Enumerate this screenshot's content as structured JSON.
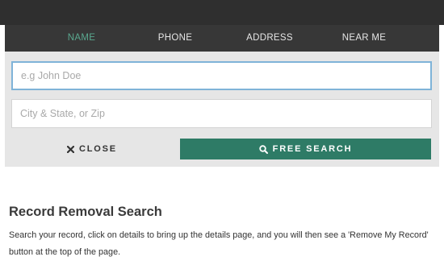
{
  "tabs": [
    {
      "label": "NAME",
      "active": true
    },
    {
      "label": "PHONE",
      "active": false
    },
    {
      "label": "ADDRESS",
      "active": false
    },
    {
      "label": "NEAR ME",
      "active": false
    }
  ],
  "search": {
    "name_placeholder": "e.g John Doe",
    "name_value": "",
    "location_placeholder": "City & State, or Zip",
    "location_value": ""
  },
  "buttons": {
    "close_label": "CLOSE",
    "close_icon": "close-icon",
    "search_label": "FREE SEARCH",
    "search_icon": "search-icon"
  },
  "content": {
    "title": "Record Removal Search",
    "description": "Search your record, click on details to bring up the details page, and you will then see a 'Remove My Record' button at the top of the page."
  },
  "colors": {
    "top_bar": "#2f2f2f",
    "tab_bar": "#373737",
    "active_tab": "#5aa88f",
    "search_button": "#2e7b66",
    "form_background": "#e6e6e6",
    "focus_border": "#7fb3d8"
  }
}
